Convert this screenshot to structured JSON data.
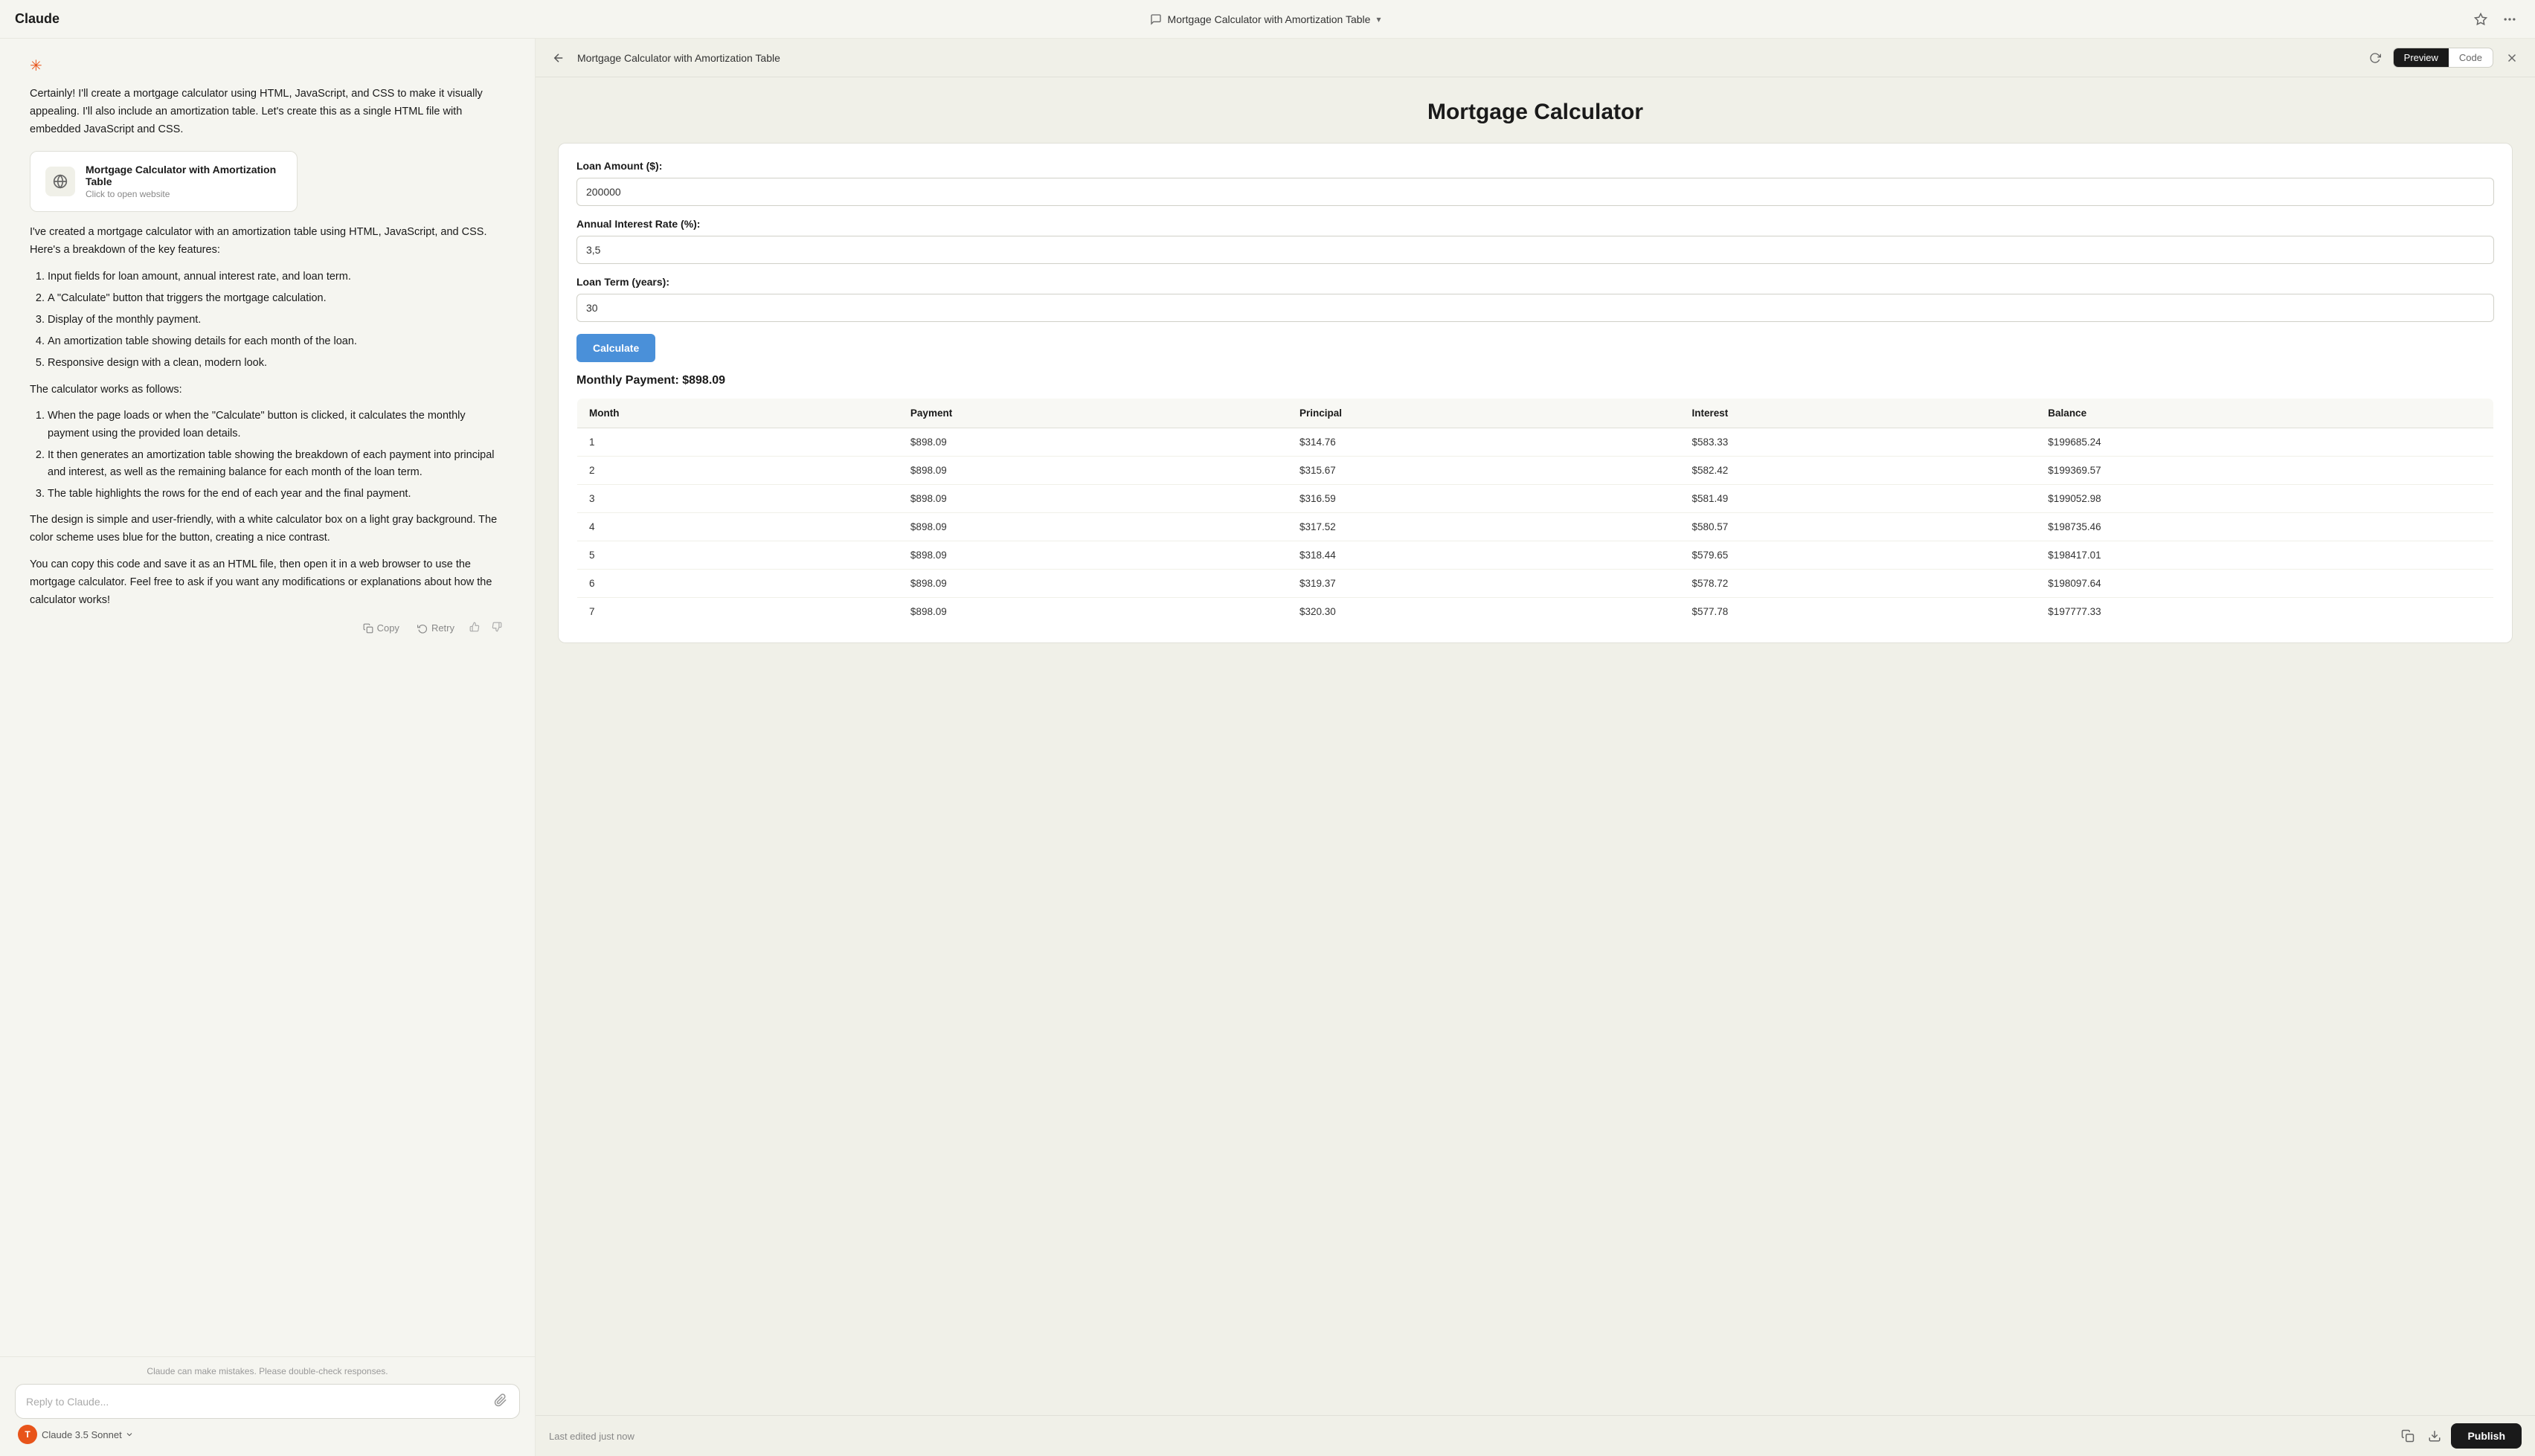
{
  "app": {
    "logo": "Claude",
    "title": "Mortgage Calculator with Amortization Table",
    "chevron": "▾"
  },
  "header": {
    "star_title": "star",
    "menu_title": "menu"
  },
  "chat": {
    "intro_para": "Certainly! I'll create a mortgage calculator using HTML, JavaScript, and CSS to make it visually appealing. I'll also include an amortization table. Let's create this as a single HTML file with embedded JavaScript and CSS.",
    "artifact": {
      "title": "Mortgage Calculator with Amortization Table",
      "subtitle": "Click to open website"
    },
    "description_para": "I've created a mortgage calculator with an amortization table using HTML, JavaScript, and CSS. Here's a breakdown of the key features:",
    "features": [
      "Input fields for loan amount, annual interest rate, and loan term.",
      "A \"Calculate\" button that triggers the mortgage calculation.",
      "Display of the monthly payment.",
      "An amortization table showing details for each month of the loan.",
      "Responsive design with a clean, modern look."
    ],
    "how_it_works_label": "The calculator works as follows:",
    "how_it_works": [
      "When the page loads or when the \"Calculate\" button is clicked, it calculates the monthly payment using the provided loan details.",
      "It then generates an amortization table showing the breakdown of each payment into principal and interest, as well as the remaining balance for each month of the loan term.",
      "The table highlights the rows for the end of each year and the final payment."
    ],
    "design_para": "The design is simple and user-friendly, with a white calculator box on a light gray background. The color scheme uses blue for the button, creating a nice contrast.",
    "closing_para": "You can copy this code and save it as an HTML file, then open it in a web browser to use the mortgage calculator. Feel free to ask if you want any modifications or explanations about how the calculator works!",
    "actions": {
      "copy": "Copy",
      "retry": "Retry"
    },
    "disclaimer": "Claude can make mistakes. Please double-check responses."
  },
  "input": {
    "placeholder": "Reply to Claude...",
    "model_label": "Claude",
    "model_version": "3.5 Sonnet"
  },
  "preview": {
    "back_icon": "←",
    "title": "Mortgage Calculator with Amortization Table",
    "tabs": [
      {
        "label": "Preview",
        "active": true
      },
      {
        "label": "Code",
        "active": false
      }
    ],
    "content": {
      "title": "Mortgage Calculator",
      "loan_amount_label": "Loan Amount ($):",
      "loan_amount_value": "200000",
      "interest_rate_label": "Annual Interest Rate (%):",
      "interest_rate_value": "3,5",
      "loan_term_label": "Loan Term (years):",
      "loan_term_value": "30",
      "calculate_btn": "Calculate",
      "monthly_payment": "Monthly Payment: $898.09",
      "table_headers": [
        "Month",
        "Payment",
        "Principal",
        "Interest",
        "Balance"
      ],
      "table_rows": [
        [
          "1",
          "$898.09",
          "$314.76",
          "$583.33",
          "$199685.24"
        ],
        [
          "2",
          "$898.09",
          "$315.67",
          "$582.42",
          "$199369.57"
        ],
        [
          "3",
          "$898.09",
          "$316.59",
          "$581.49",
          "$199052.98"
        ],
        [
          "4",
          "$898.09",
          "$317.52",
          "$580.57",
          "$198735.46"
        ],
        [
          "5",
          "$898.09",
          "$318.44",
          "$579.65",
          "$198417.01"
        ],
        [
          "6",
          "$898.09",
          "$319.37",
          "$578.72",
          "$198097.64"
        ],
        [
          "7",
          "$898.09",
          "$320.30",
          "$577.78",
          "$197777.33"
        ]
      ]
    },
    "footer": {
      "last_edited": "Last edited just now",
      "copy_icon": "copy",
      "download_icon": "download",
      "publish_btn": "Publish"
    }
  }
}
